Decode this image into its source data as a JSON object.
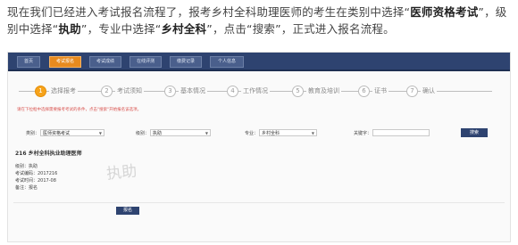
{
  "intro": {
    "part1": "现在我们已经进入考试报名流程了，报考乡村全科助理医师的考生在类别中选择“",
    "category": "医师资格考试",
    "part2": "”，级别中选择“",
    "level": "执助",
    "part3": "”，专业中选择“",
    "major": "乡村全科",
    "part4": "”，点击“搜索”，正式进入报名流程。"
  },
  "nav": {
    "tabs": [
      "首页",
      "考试报名",
      "考试成绩",
      "在线评测",
      "缴费记录",
      "个人信息"
    ],
    "active_index": 1
  },
  "steps": [
    {
      "num": "1",
      "label": "选择报考"
    },
    {
      "num": "2",
      "label": "考试须知"
    },
    {
      "num": "3",
      "label": "基本情况"
    },
    {
      "num": "4",
      "label": "工作情况"
    },
    {
      "num": "5",
      "label": "教育及培训"
    },
    {
      "num": "6",
      "label": "证书"
    },
    {
      "num": "7",
      "label": "确认"
    }
  ],
  "hint": "请在下拉框中选择需要报考考试的条件，点击\"搜索\"开始报名该选项。",
  "filters": {
    "category_label": "类别：",
    "category_value": "医师资格考试",
    "level_label": "级别：",
    "level_value": "执助",
    "major_label": "专业：",
    "major_value": "乡村全科",
    "keyword_label": "关键字：",
    "keyword_value": "",
    "search_button": "搜索"
  },
  "result": {
    "title": "216 乡村全科执业助理医师",
    "watermark": "执助",
    "rows": [
      "级别：执助",
      "考试编码：2017216",
      "考试时间：2017-08",
      "备注：报名"
    ],
    "report_button": "报名"
  }
}
